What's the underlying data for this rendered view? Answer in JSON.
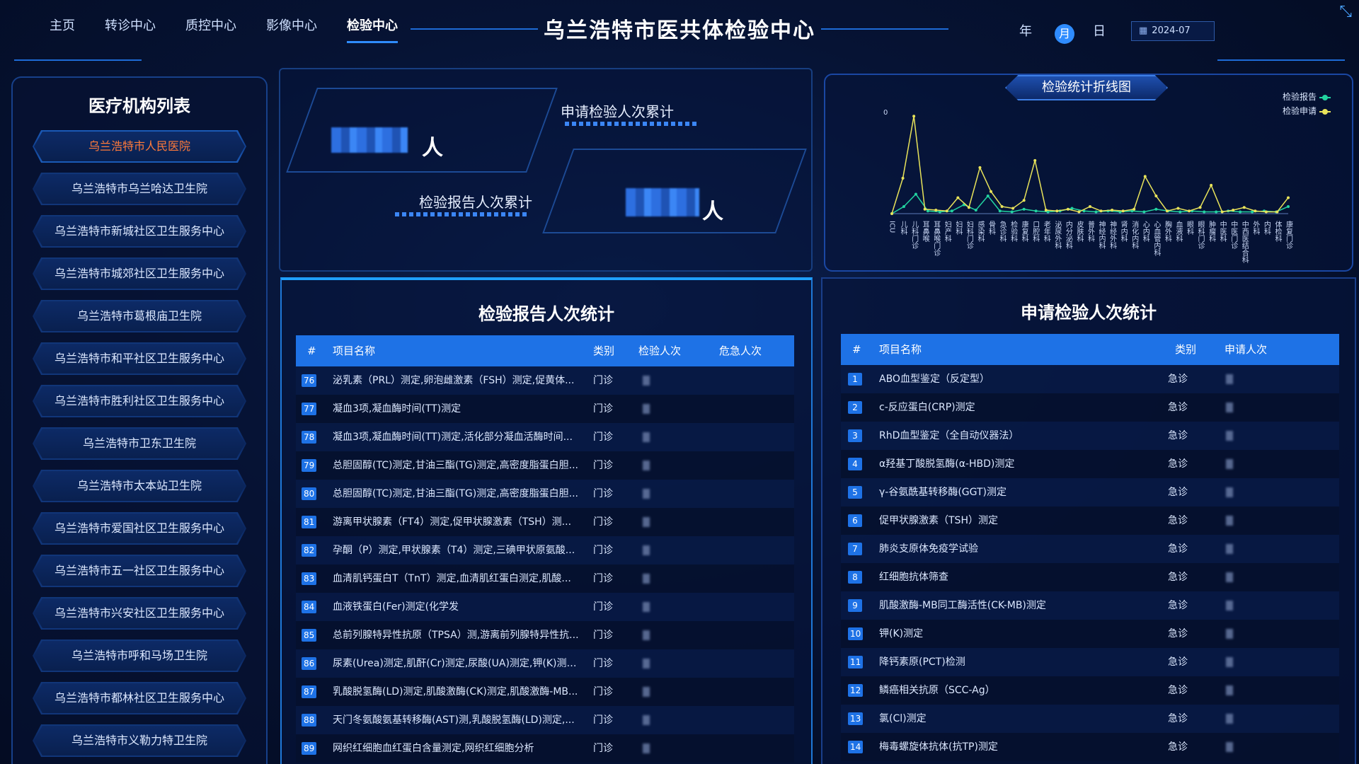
{
  "header": {
    "title": "乌兰浩特市医共体检验中心",
    "nav": [
      "主页",
      "转诊中心",
      "质控中心",
      "影像中心",
      "检验中心"
    ],
    "active_nav": 4,
    "period": {
      "year": "年",
      "month": "月",
      "day": "日"
    },
    "date": "2024-07"
  },
  "sidebar": {
    "title": "医疗机构列表",
    "selected": 0,
    "items": [
      "乌兰浩特市人民医院",
      "乌兰浩特市乌兰哈达卫生院",
      "乌兰浩特市新城社区卫生服务中心",
      "乌兰浩特市城郊社区卫生服务中心",
      "乌兰浩特市葛根庙卫生院",
      "乌兰浩特市和平社区卫生服务中心",
      "乌兰浩特市胜利社区卫生服务中心",
      "乌兰浩特市卫东卫生院",
      "乌兰浩特市太本站卫生院",
      "乌兰浩特市爱国社区卫生服务中心",
      "乌兰浩特市五一社区卫生服务中心",
      "乌兰浩特市兴安社区卫生服务中心",
      "乌兰浩特市呼和马场卫生院",
      "乌兰浩特市都林社区卫生服务中心",
      "乌兰浩特市义勒力特卫生院"
    ]
  },
  "totals": {
    "apply_label": "申请检验人次累计",
    "report_label": "检验报告人次累计",
    "unit": "人"
  },
  "chart_data": {
    "type": "line",
    "title": "检验统计折线图",
    "legend_position": "top-right",
    "series": [
      {
        "name": "检验报告",
        "color": "#22d3a0",
        "values": [
          0,
          8,
          22,
          3,
          2,
          3,
          10,
          4,
          20,
          3,
          2,
          5,
          3,
          2,
          3,
          6,
          3,
          2,
          3,
          2,
          3,
          2,
          5,
          3,
          2,
          3,
          2,
          2,
          3,
          2,
          2,
          3,
          2,
          8
        ]
      },
      {
        "name": "检验申请",
        "color": "#e8e35a",
        "values": [
          0,
          40,
          110,
          5,
          4,
          3,
          18,
          7,
          52,
          25,
          8,
          6,
          15,
          60,
          4,
          3,
          5,
          2,
          8,
          3,
          4,
          3,
          5,
          42,
          20,
          3,
          6,
          3,
          7,
          32,
          2,
          4,
          7,
          3,
          2,
          2,
          18
        ]
      }
    ],
    "y_tick_label": "0",
    "x_categories": [
      "ICU",
      "儿科",
      "儿科门诊",
      "耳鼻喉",
      "耳鼻喉门诊",
      "妇产科",
      "妇科",
      "妇科门诊",
      "感染科",
      "骨科",
      "急诊科",
      "检验科",
      "康复科",
      "口腔科",
      "老年科",
      "泌尿外科",
      "内分泌科",
      "皮肤科",
      "普外科",
      "神经内科",
      "神经外科",
      "肾内科",
      "消化内科",
      "心内科",
      "心血管内科",
      "胸外科",
      "血液科",
      "眼科",
      "眼科门诊",
      "肿瘤科",
      "中医科",
      "中医门诊",
      "中西医结合科",
      "外科",
      "内科",
      "体检科",
      "康复门诊"
    ]
  },
  "report_table": {
    "title": "检验报告人次统计",
    "columns": [
      "#",
      "项目名称",
      "类别",
      "检验人次",
      "危急人次"
    ],
    "rows": [
      {
        "idx": "76",
        "name": "泌乳素（PRL）测定,卵泡雌激素（FSH）测定,促黄体...",
        "type": "门诊"
      },
      {
        "idx": "77",
        "name": "凝血3项,凝血酶时间(TT)测定",
        "type": "门诊"
      },
      {
        "idx": "78",
        "name": "凝血3项,凝血酶时间(TT)测定,活化部分凝血活酶时间...",
        "type": "门诊"
      },
      {
        "idx": "79",
        "name": "总胆固醇(TC)测定,甘油三酯(TG)测定,高密度脂蛋白胆...",
        "type": "门诊"
      },
      {
        "idx": "80",
        "name": "总胆固醇(TC)测定,甘油三酯(TG)测定,高密度脂蛋白胆...",
        "type": "门诊"
      },
      {
        "idx": "81",
        "name": "游离甲状腺素（FT4）测定,促甲状腺激素（TSH）测...",
        "type": "门诊"
      },
      {
        "idx": "82",
        "name": "孕酮（P）测定,甲状腺素（T4）测定,三碘甲状原氨酸...",
        "type": "门诊"
      },
      {
        "idx": "83",
        "name": "血清肌钙蛋白T（TnT）测定,血清肌红蛋白测定,肌酸...",
        "type": "门诊"
      },
      {
        "idx": "84",
        "name": "血液铁蛋白(Fer)测定(化学发",
        "type": "门诊"
      },
      {
        "idx": "85",
        "name": "总前列腺特异性抗原（TPSA）测,游离前列腺特异性抗...",
        "type": "门诊"
      },
      {
        "idx": "86",
        "name": "尿素(Urea)测定,肌酐(Cr)测定,尿酸(UA)测定,钾(K)测定...",
        "type": "门诊"
      },
      {
        "idx": "87",
        "name": "乳酸脱氢酶(LD)测定,肌酸激酶(CK)测定,肌酸激酶-MB...",
        "type": "门诊"
      },
      {
        "idx": "88",
        "name": "天门冬氨酸氨基转移酶(AST)测,乳酸脱氢酶(LD)测定,...",
        "type": "门诊"
      },
      {
        "idx": "89",
        "name": "网织红细胞血红蛋白含量测定,网织红细胞分析",
        "type": "门诊"
      }
    ]
  },
  "apply_table": {
    "title": "申请检验人次统计",
    "columns": [
      "#",
      "项目名称",
      "类别",
      "申请人次"
    ],
    "rows": [
      {
        "idx": "1",
        "name": "ABO血型鉴定（反定型）",
        "type": "急诊"
      },
      {
        "idx": "2",
        "name": "c-反应蛋白(CRP)测定",
        "type": "急诊"
      },
      {
        "idx": "3",
        "name": "RhD血型鉴定（全自动仪器法）",
        "type": "急诊"
      },
      {
        "idx": "4",
        "name": "α羟基丁酸脱氢酶(α-HBD)测定",
        "type": "急诊"
      },
      {
        "idx": "5",
        "name": "γ-谷氨酰基转移酶(GGT)测定",
        "type": "急诊"
      },
      {
        "idx": "6",
        "name": "促甲状腺激素（TSH）测定",
        "type": "急诊"
      },
      {
        "idx": "7",
        "name": "肺炎支原体免疫学试验",
        "type": "急诊"
      },
      {
        "idx": "8",
        "name": "红细胞抗体筛查",
        "type": "急诊"
      },
      {
        "idx": "9",
        "name": "肌酸激酶-MB同工酶活性(CK-MB)测定",
        "type": "急诊"
      },
      {
        "idx": "10",
        "name": "钾(K)测定",
        "type": "急诊"
      },
      {
        "idx": "11",
        "name": "降钙素原(PCT)检测",
        "type": "急诊"
      },
      {
        "idx": "12",
        "name": "鳞癌相关抗原（SCC-Ag）",
        "type": "急诊"
      },
      {
        "idx": "13",
        "name": "氯(Cl)测定",
        "type": "急诊"
      },
      {
        "idx": "14",
        "name": "梅毒螺旋体抗体(抗TP)测定",
        "type": "急诊"
      }
    ]
  }
}
